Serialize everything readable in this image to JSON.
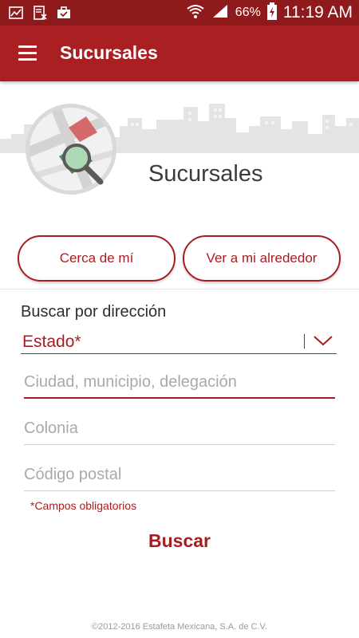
{
  "status_bar": {
    "battery": "66%",
    "time": "11:19 AM"
  },
  "toolbar": {
    "title": "Sucursales"
  },
  "hero": {
    "title": "Sucursales"
  },
  "buttons": {
    "near_me": "Cerca de mí",
    "around_me": "Ver a mi alrededor"
  },
  "search": {
    "section_label": "Buscar por dirección",
    "state_select": "Estado*",
    "city_placeholder": "Ciudad, municipio, delegación",
    "colonia_placeholder": "Colonia",
    "postal_placeholder": "Código postal",
    "required_note": "*Campos obligatorios",
    "submit_label": "Buscar"
  },
  "footer": {
    "copyright": "©2012-2016 Estafeta Mexicana, S.A. de C.V."
  },
  "colors": {
    "primary": "#aa1f22",
    "status_bar": "#8f1a1c",
    "accent_text": "#a81d20"
  }
}
